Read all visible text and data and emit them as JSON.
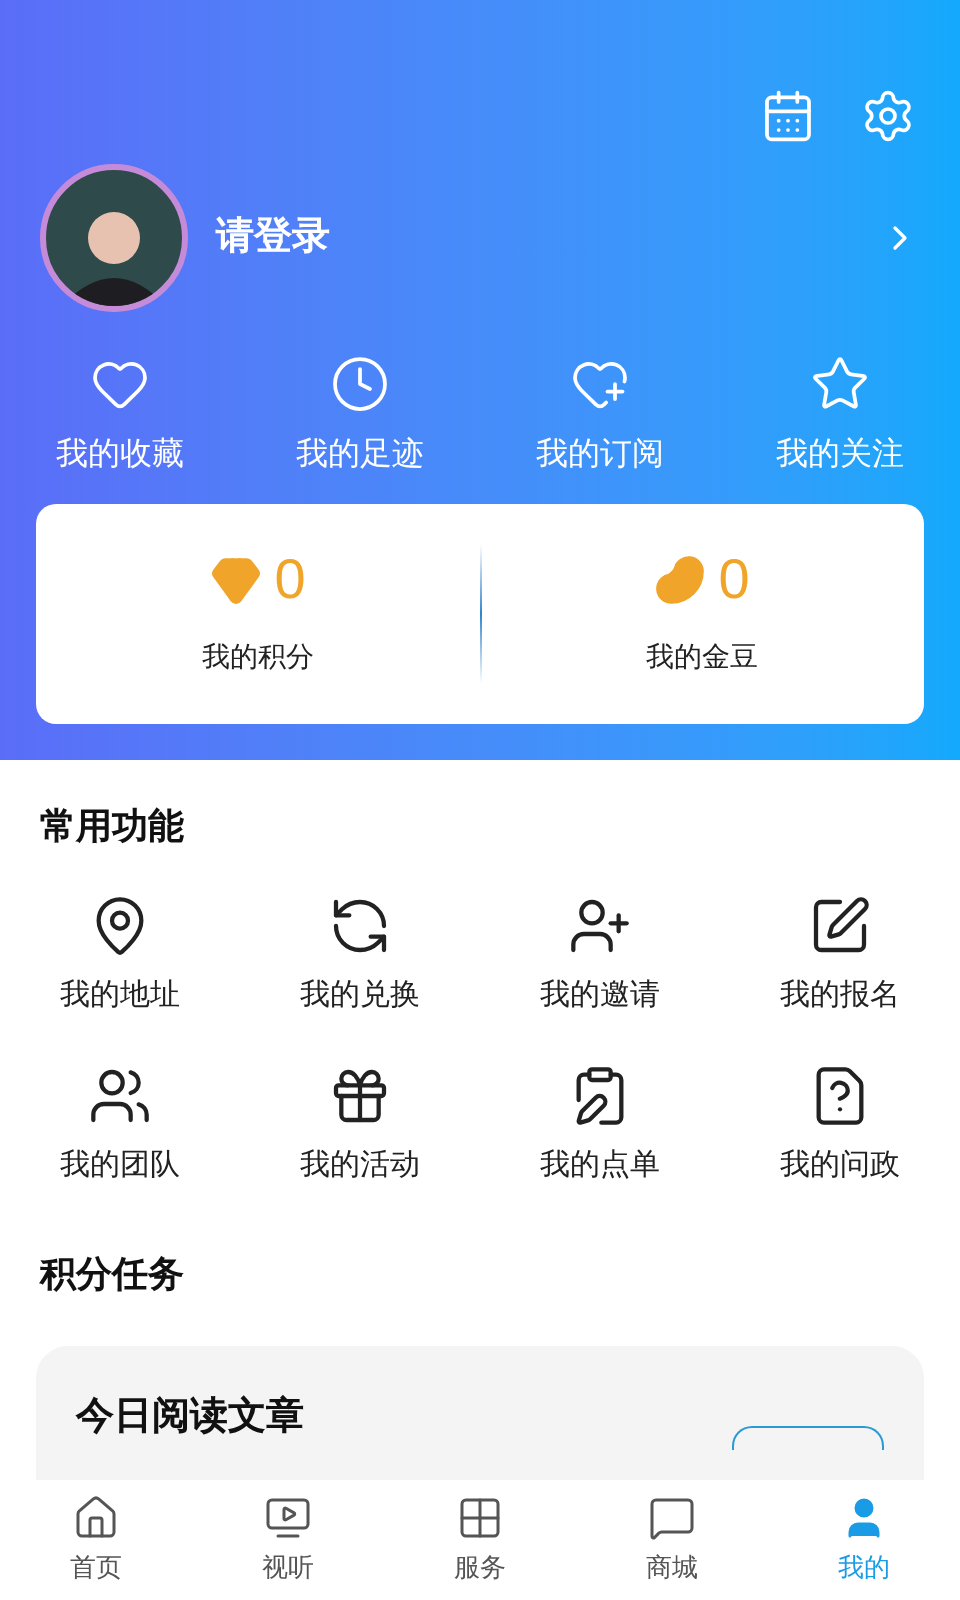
{
  "profile": {
    "login_prompt": "请登录"
  },
  "quick_links": [
    {
      "label": "我的收藏",
      "kind": "heart"
    },
    {
      "label": "我的足迹",
      "kind": "clock"
    },
    {
      "label": "我的订阅",
      "kind": "heart-plus"
    },
    {
      "label": "我的关注",
      "kind": "star"
    }
  ],
  "stats": [
    {
      "value": "0",
      "label": "我的积分",
      "kind": "gem"
    },
    {
      "value": "0",
      "label": "我的金豆",
      "kind": "bean"
    }
  ],
  "common_functions": {
    "title": "常用功能",
    "items": [
      {
        "label": "我的地址",
        "kind": "map"
      },
      {
        "label": "我的兑换",
        "kind": "exchange"
      },
      {
        "label": "我的邀请",
        "kind": "user-plus"
      },
      {
        "label": "我的报名",
        "kind": "edit"
      },
      {
        "label": "我的团队",
        "kind": "users"
      },
      {
        "label": "我的活动",
        "kind": "gift"
      },
      {
        "label": "我的点单",
        "kind": "clipboard"
      },
      {
        "label": "我的问政",
        "kind": "question"
      }
    ]
  },
  "point_tasks": {
    "title": "积分任务",
    "tasks": [
      {
        "title": "今日阅读文章"
      }
    ]
  },
  "tab_bar": [
    {
      "label": "首页",
      "kind": "home",
      "selected": false
    },
    {
      "label": "视听",
      "kind": "video",
      "selected": false
    },
    {
      "label": "服务",
      "kind": "grid",
      "selected": false
    },
    {
      "label": "商城",
      "kind": "chat",
      "selected": false
    },
    {
      "label": "我的",
      "kind": "user",
      "selected": true
    }
  ]
}
